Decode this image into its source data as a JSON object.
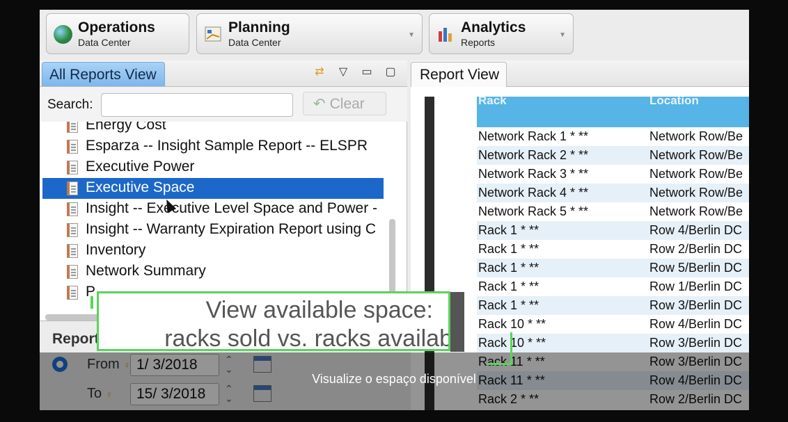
{
  "perspectives": [
    {
      "title": "Operations",
      "subtitle": "Data Center"
    },
    {
      "title": "Planning",
      "subtitle": "Data Center"
    },
    {
      "title": "Analytics",
      "subtitle": "Reports"
    }
  ],
  "left_panel": {
    "tab_label": "All Reports View",
    "search_label": "Search:",
    "search_value": "",
    "clear_label": "Clear",
    "tree_items": [
      {
        "label": "Energy Cost"
      },
      {
        "label": "Esparza -- Insight Sample Report -- ELSPR"
      },
      {
        "label": "Executive Power"
      },
      {
        "label": "Executive Space",
        "selected": true
      },
      {
        "label": "Insight -- Executive Level Space and Power -"
      },
      {
        "label": "Insight -- Warranty Expiration Report using C"
      },
      {
        "label": "Inventory"
      },
      {
        "label": "Network Summary"
      },
      {
        "label": "P"
      }
    ],
    "report_section_label": "Report",
    "from_label": "From",
    "from_date": "1/ 3/2018",
    "to_label": "To",
    "to_date": "15/ 3/2018"
  },
  "right_panel": {
    "tab_label": "Report View",
    "table": {
      "headers": [
        "Rack",
        "Location"
      ],
      "rows": [
        [
          "Network Rack 1 * **",
          "Network Row/Be"
        ],
        [
          "Network Rack 2 * **",
          "Network Row/Be"
        ],
        [
          "Network Rack 3 * **",
          "Network Row/Be"
        ],
        [
          "Network Rack 4 * **",
          "Network Row/Be"
        ],
        [
          "Network Rack 5 * **",
          "Network Row/Be"
        ],
        [
          "Rack 1 * **",
          "Row 4/Berlin DC"
        ],
        [
          "Rack 1 * **",
          "Row 2/Berlin DC"
        ],
        [
          "Rack 1 * **",
          "Row 5/Berlin DC"
        ],
        [
          "Rack 1 * **",
          "Row 1/Berlin DC"
        ],
        [
          "Rack 1 * **",
          "Row 3/Berlin DC"
        ],
        [
          "Rack 10 * **",
          "Row 4/Berlin DC"
        ],
        [
          "Rack 10 * **",
          "Row 3/Berlin DC"
        ],
        [
          "Rack 11 * **",
          "Row 3/Berlin DC"
        ],
        [
          "Rack 11 * **",
          "Row 4/Berlin DC"
        ],
        [
          "Rack 2 * **",
          "Row 2/Berlin DC"
        ]
      ]
    }
  },
  "overlay": {
    "caption_line1": "View available space:",
    "caption_line2": "racks sold vs. racks availab",
    "subtitle": "Visualize o espaço disponível"
  }
}
